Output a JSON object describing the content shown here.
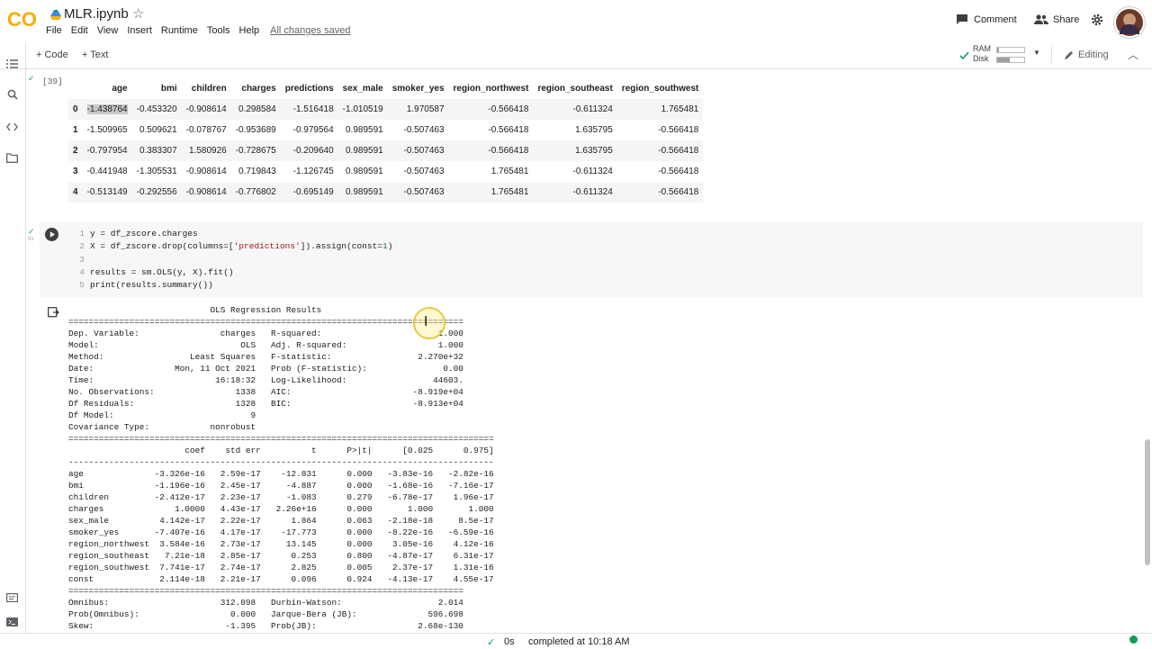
{
  "app": {
    "logo_text": "CO",
    "notebook_title": "MLR.ipynb",
    "menu": [
      "File",
      "Edit",
      "View",
      "Insert",
      "Runtime",
      "Tools",
      "Help"
    ],
    "save_status": "All changes saved",
    "comment_label": "Comment",
    "share_label": "Share"
  },
  "toolbar": {
    "add_code": "+ Code",
    "add_text": "+ Text",
    "ram_label": "RAM",
    "disk_label": "Disk",
    "editing_label": "Editing"
  },
  "cell1": {
    "exec_count": "[39]",
    "columns": [
      "",
      "age",
      "bmi",
      "children",
      "charges",
      "predictions",
      "sex_male",
      "smoker_yes",
      "region_northwest",
      "region_southeast",
      "region_southwest"
    ],
    "rows": [
      [
        "0",
        "-1.438764",
        "-0.453320",
        "-0.908614",
        "0.298584",
        "-1.516418",
        "-1.010519",
        "1.970587",
        "-0.566418",
        "-0.611324",
        "1.765481"
      ],
      [
        "1",
        "-1.509965",
        "0.509621",
        "-0.078767",
        "-0.953689",
        "-0.979564",
        "0.989591",
        "-0.507463",
        "-0.566418",
        "1.635795",
        "-0.566418"
      ],
      [
        "2",
        "-0.797954",
        "0.383307",
        "1.580926",
        "-0.728675",
        "-0.209640",
        "0.989591",
        "-0.507463",
        "-0.566418",
        "1.635795",
        "-0.566418"
      ],
      [
        "3",
        "-0.441948",
        "-1.305531",
        "-0.908614",
        "0.719843",
        "-1.126745",
        "0.989591",
        "-0.507463",
        "1.765481",
        "-0.611324",
        "-0.566418"
      ],
      [
        "4",
        "-0.513149",
        "-0.292556",
        "-0.908614",
        "-0.776802",
        "-0.695149",
        "0.989591",
        "-0.507463",
        "1.765481",
        "-0.611324",
        "-0.566418"
      ]
    ]
  },
  "cell2": {
    "exec_time": "0s",
    "code": {
      "l1": "y = df_zscore.charges",
      "l2a": "X = df_zscore.drop(columns=[",
      "l2s": "'predictions'",
      "l2b": "]).assign(const=",
      "l2n": "1",
      "l2c": ")",
      "l4": "results = sm.OLS(y, X).fit()",
      "l5": "print(results.summary())"
    },
    "line_numbers": [
      "1",
      "2",
      "3",
      "4",
      "5"
    ],
    "output": "                            OLS Regression Results                            \n==============================================================================\nDep. Variable:                charges   R-squared:                       1.000\nModel:                            OLS   Adj. R-squared:                  1.000\nMethod:                 Least Squares   F-statistic:                 2.270e+32\nDate:                Mon, 11 Oct 2021   Prob (F-statistic):               0.00\nTime:                        16:18:32   Log-Likelihood:                 44603.\nNo. Observations:                1338   AIC:                        -8.919e+04\nDf Residuals:                    1328   BIC:                        -8.913e+04\nDf Model:                           9                                         \nCovariance Type:            nonrobust                                         \n====================================================================================\n                       coef    std err          t      P>|t|      [0.025      0.975]\n------------------------------------------------------------------------------------\nage              -3.326e-16   2.59e-17    -12.831      0.000   -3.83e-16   -2.82e-16\nbmi              -1.196e-16   2.45e-17     -4.887      0.000   -1.68e-16   -7.16e-17\nchildren         -2.412e-17   2.23e-17     -1.083      0.279   -6.78e-17    1.96e-17\ncharges              1.0000   4.43e-17   2.26e+16      0.000       1.000       1.000\nsex_male          4.142e-17   2.22e-17      1.864      0.063   -2.18e-18     8.5e-17\nsmoker_yes       -7.407e-16   4.17e-17    -17.773      0.000   -8.22e-16   -6.59e-16\nregion_northwest  3.584e-16   2.73e-17     13.145      0.000    3.05e-16    4.12e-16\nregion_southeast   7.21e-18   2.85e-17      0.253      0.800   -4.87e-17    6.31e-17\nregion_southwest  7.741e-17   2.74e-17      2.825      0.005    2.37e-17    1.31e-16\nconst             2.114e-18   2.21e-17      0.096      0.924   -4.13e-17    4.55e-17\n==============================================================================\nOmnibus:                      312.098   Durbin-Watson:                   2.014\nProb(Omnibus):                  0.000   Jarque-Bera (JB):              596.698\nSkew:                          -1.395   Prob(JB):                    2.68e-130"
  },
  "status_bar": {
    "exec_time": "0s",
    "completed": "completed at 10:18 AM"
  },
  "colors": {
    "logo_orange": "#f9ab00",
    "check_green": "#0f9d58",
    "accent": "#1a73e8"
  }
}
